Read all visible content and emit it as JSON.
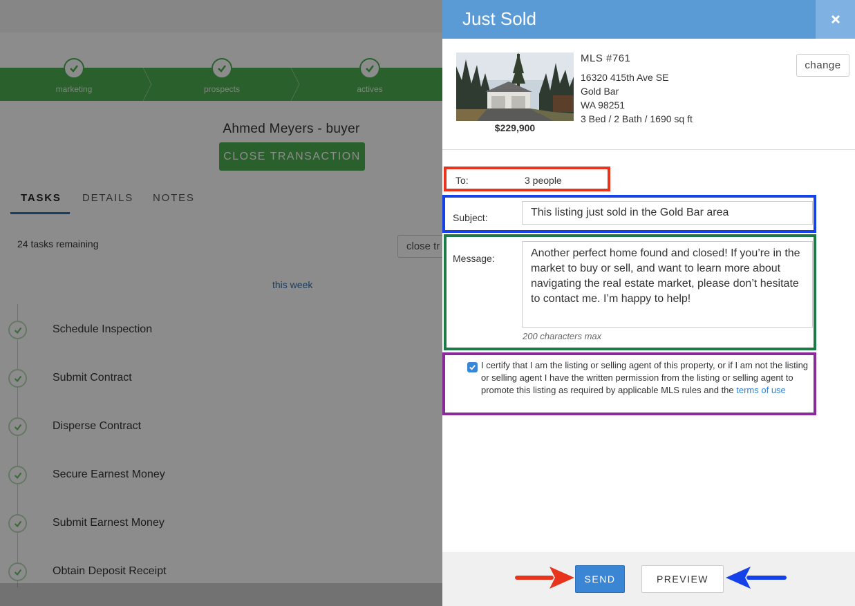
{
  "progress": {
    "stages": [
      {
        "label": "marketing"
      },
      {
        "label": "prospects"
      },
      {
        "label": "actives"
      }
    ]
  },
  "client": {
    "name": "Ahmed Meyers - buyer",
    "close_transaction_label": "CLOSE TRANSACTION"
  },
  "tabs": [
    {
      "label": "TASKS",
      "active": true
    },
    {
      "label": "DETAILS",
      "active": false
    },
    {
      "label": "NOTES",
      "active": false
    }
  ],
  "tasks": {
    "remaining": "24 tasks remaining",
    "close_button_label": "close tr",
    "period": "this week",
    "items": [
      {
        "name": "Schedule Inspection",
        "done": true
      },
      {
        "name": "Submit Contract",
        "done": true
      },
      {
        "name": "Disperse Contract",
        "done": true
      },
      {
        "name": "Secure Earnest Money",
        "done": true
      },
      {
        "name": "Submit Earnest Money",
        "done": true
      },
      {
        "name": "Obtain Deposit Receipt",
        "done": true
      }
    ]
  },
  "panel": {
    "title": "Just Sold",
    "close_icon": "close-icon",
    "listing": {
      "mls": "MLS #761",
      "address_line1": "16320 415th Ave SE",
      "city": "Gold Bar",
      "state_zip": "WA 98251",
      "details": "3 Bed / 2 Bath / 1690 sq ft",
      "price": "$229,900",
      "change_label": "change"
    },
    "form": {
      "to_label": "To:",
      "to_value": "3 people",
      "subject_label": "Subject:",
      "subject_value": "This listing just sold in the Gold Bar area",
      "message_label": "Message:",
      "message_value": "Another perfect home found and closed! If you’re in the market to buy or sell, and want to learn more about navigating the real estate market, please don’t hesitate to contact me. I’m happy to help!",
      "message_hint": "200 characters max",
      "certify_text": "I certify that I am the listing or selling agent of this property, or if I am not the listing or selling agent I have the written permission from the listing or selling agent to promote this listing as required by applicable MLS rules and the ",
      "terms_link": "terms of use",
      "certify_checked": true
    },
    "footer": {
      "send_label": "SEND",
      "preview_label": "PREVIEW"
    }
  },
  "colors": {
    "header_blue": "#5b9bd5",
    "progress_green": "#4caf50",
    "annotation_red": "#e8341c",
    "annotation_blue": "#1541e8",
    "annotation_green": "#1c7a47",
    "annotation_purple": "#8b2a9b"
  }
}
